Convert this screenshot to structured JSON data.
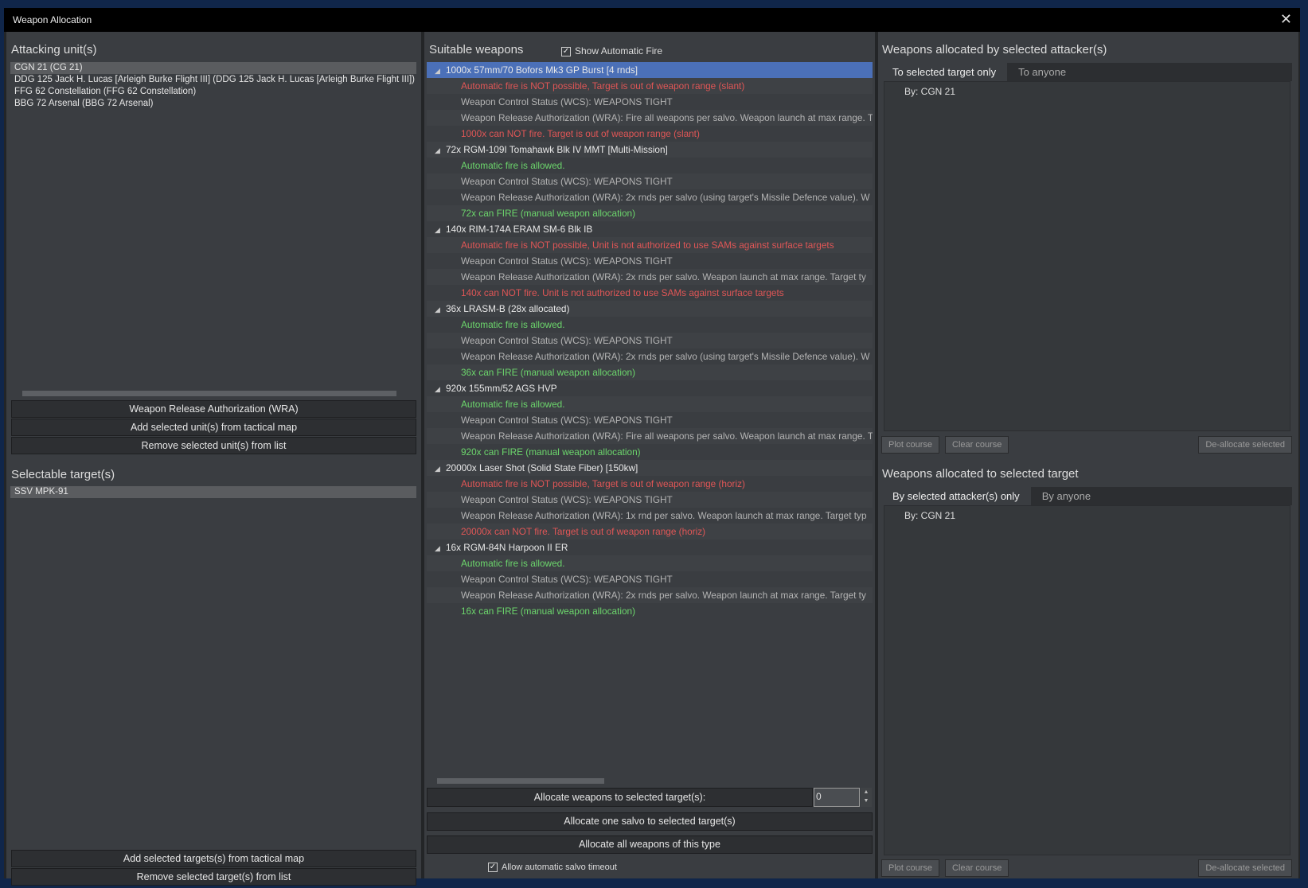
{
  "window": {
    "title": "Weapon Allocation",
    "close_icon": "close-icon"
  },
  "attackers": {
    "heading": "Attacking unit(s)",
    "items": [
      "CGN 21 (CG 21)",
      "DDG 125 Jack H. Lucas [Arleigh Burke Flight III] (DDG 125 Jack H. Lucas [Arleigh Burke Flight III])",
      "FFG 62 Constellation (FFG 62 Constellation)",
      "BBG 72 Arsenal (BBG 72 Arsenal)"
    ],
    "buttons": {
      "wra": "Weapon Release Authorization (WRA)",
      "add": "Add selected unit(s) from tactical map",
      "remove": "Remove selected unit(s) from list"
    }
  },
  "targets": {
    "heading": "Selectable target(s)",
    "items": [
      "SSV MPK-91"
    ],
    "buttons": {
      "add": "Add selected targets(s) from tactical map",
      "remove": "Remove selected target(s) from list"
    }
  },
  "weapons": {
    "heading": "Suitable weapons",
    "show_auto_fire": "Show Automatic Fire",
    "show_auto_fire_checked": true,
    "list": [
      {
        "name": "1000x 57mm/70 Bofors Mk3 GP Burst [4 rnds]",
        "selected": true,
        "lines": [
          {
            "text": "Automatic fire is NOT possible, Target is out of weapon range (slant)",
            "status": "red"
          },
          {
            "text": "Weapon Control Status (WCS): WEAPONS TIGHT",
            "status": "gray"
          },
          {
            "text": "Weapon Release Authorization (WRA): Fire all weapons per salvo. Weapon launch at max range.  T",
            "status": "gray"
          },
          {
            "text": "1000x can NOT fire. Target is out of weapon range (slant)",
            "status": "red"
          }
        ]
      },
      {
        "name": "72x RGM-109I Tomahawk Blk IV MMT [Multi-Mission]",
        "lines": [
          {
            "text": "Automatic fire is allowed.",
            "status": "green"
          },
          {
            "text": "Weapon Control Status (WCS): WEAPONS TIGHT",
            "status": "gray"
          },
          {
            "text": "Weapon Release Authorization (WRA): 2x rnds per salvo (using target's Missile Defence value). W",
            "status": "gray"
          },
          {
            "text": "72x can FIRE (manual weapon allocation)",
            "status": "green"
          }
        ]
      },
      {
        "name": "140x RIM-174A ERAM SM-6 Blk IB",
        "lines": [
          {
            "text": "Automatic fire is NOT possible, Unit is not authorized to use SAMs against surface targets",
            "status": "red"
          },
          {
            "text": "Weapon Control Status (WCS): WEAPONS TIGHT",
            "status": "gray"
          },
          {
            "text": "Weapon Release Authorization (WRA): 2x rnds per salvo. Weapon launch at max range.  Target ty",
            "status": "gray"
          },
          {
            "text": "140x can NOT fire. Unit is not authorized to use SAMs against surface targets",
            "status": "red"
          }
        ]
      },
      {
        "name": "36x LRASM-B (28x allocated)",
        "lines": [
          {
            "text": "Automatic fire is allowed.",
            "status": "green"
          },
          {
            "text": "Weapon Control Status (WCS): WEAPONS TIGHT",
            "status": "gray"
          },
          {
            "text": "Weapon Release Authorization (WRA): 2x rnds per salvo (using target's Missile Defence value). W",
            "status": "gray"
          },
          {
            "text": "36x can FIRE (manual weapon allocation)",
            "status": "green"
          }
        ]
      },
      {
        "name": "920x 155mm/52 AGS HVP",
        "lines": [
          {
            "text": "Automatic fire is allowed.",
            "status": "green"
          },
          {
            "text": "Weapon Control Status (WCS): WEAPONS TIGHT",
            "status": "gray"
          },
          {
            "text": "Weapon Release Authorization (WRA): Fire all weapons per salvo. Weapon launch at max range.  T",
            "status": "gray"
          },
          {
            "text": "920x can FIRE (manual weapon allocation)",
            "status": "green"
          }
        ]
      },
      {
        "name": "20000x Laser Shot (Solid State Fiber) [150kw]",
        "lines": [
          {
            "text": "Automatic fire is NOT possible, Target is out of weapon range (horiz)",
            "status": "red"
          },
          {
            "text": "Weapon Control Status (WCS): WEAPONS TIGHT",
            "status": "gray"
          },
          {
            "text": "Weapon Release Authorization (WRA): 1x rnd per salvo. Weapon launch at max range.  Target typ",
            "status": "gray"
          },
          {
            "text": "20000x can NOT fire. Target is out of weapon range (horiz)",
            "status": "red"
          }
        ]
      },
      {
        "name": "16x RGM-84N Harpoon II ER",
        "lines": [
          {
            "text": "Automatic fire is allowed.",
            "status": "green"
          },
          {
            "text": "Weapon Control Status (WCS): WEAPONS TIGHT",
            "status": "gray"
          },
          {
            "text": "Weapon Release Authorization (WRA): 2x rnds per salvo. Weapon launch at max range.  Target ty",
            "status": "gray"
          },
          {
            "text": "16x can FIRE (manual weapon allocation)",
            "status": "green"
          }
        ]
      }
    ],
    "allocate_label": "Allocate weapons to selected target(s):",
    "allocate_qty": "0",
    "salvo_button": "Allocate one salvo to selected target(s)",
    "all_button": "Allocate all weapons of this type",
    "salvo_timeout": "Allow automatic salvo timeout",
    "salvo_timeout_checked": true
  },
  "by_attacker": {
    "heading": "Weapons allocated by selected attacker(s)",
    "tabs": [
      "To selected target only",
      "To anyone"
    ],
    "items": [
      "By: CGN 21"
    ]
  },
  "to_target": {
    "heading": "Weapons allocated to selected target",
    "tabs": [
      "By selected attacker(s) only",
      "By anyone"
    ],
    "items": [
      "By: CGN 21"
    ]
  },
  "common_buttons": {
    "plot": "Plot course",
    "clear": "Clear course",
    "deallocate": "De-allocate selected"
  },
  "colors": {
    "selected": "#4b70b8",
    "red": "#e05656",
    "green": "#6cd66c"
  }
}
